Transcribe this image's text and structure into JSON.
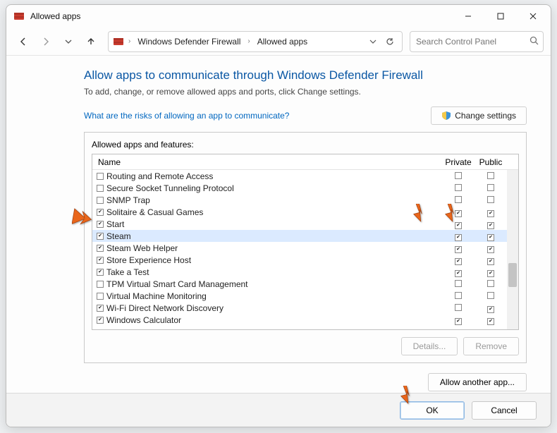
{
  "window": {
    "title": "Allowed apps"
  },
  "nav": {
    "breadcrumb": {
      "seg1": "Windows Defender Firewall",
      "seg2": "Allowed apps"
    },
    "search_placeholder": "Search Control Panel"
  },
  "page": {
    "heading": "Allow apps to communicate through Windows Defender Firewall",
    "sub": "To add, change, or remove allowed apps and ports, click Change settings.",
    "risk_link": "What are the risks of allowing an app to communicate?",
    "change_settings": "Change settings"
  },
  "list": {
    "label": "Allowed apps and features:",
    "col_name": "Name",
    "col_private": "Private",
    "col_public": "Public",
    "rows": [
      {
        "enabled": false,
        "name": "Routing and Remote Access",
        "private": false,
        "public": false
      },
      {
        "enabled": false,
        "name": "Secure Socket Tunneling Protocol",
        "private": false,
        "public": false
      },
      {
        "enabled": false,
        "name": "SNMP Trap",
        "private": false,
        "public": false
      },
      {
        "enabled": true,
        "name": "Solitaire & Casual Games",
        "private": true,
        "public": true
      },
      {
        "enabled": true,
        "name": "Start",
        "private": true,
        "public": true
      },
      {
        "enabled": true,
        "name": "Steam",
        "private": true,
        "public": true,
        "selected": true
      },
      {
        "enabled": true,
        "name": "Steam Web Helper",
        "private": true,
        "public": true
      },
      {
        "enabled": true,
        "name": "Store Experience Host",
        "private": true,
        "public": true
      },
      {
        "enabled": true,
        "name": "Take a Test",
        "private": true,
        "public": true
      },
      {
        "enabled": false,
        "name": "TPM Virtual Smart Card Management",
        "private": false,
        "public": false
      },
      {
        "enabled": false,
        "name": "Virtual Machine Monitoring",
        "private": false,
        "public": false
      },
      {
        "enabled": true,
        "name": "Wi-Fi Direct Network Discovery",
        "private": false,
        "public": true
      },
      {
        "enabled": true,
        "name": "Windows Calculator",
        "private": true,
        "public": true
      }
    ],
    "details": "Details...",
    "remove": "Remove",
    "allow_another": "Allow another app..."
  },
  "footer": {
    "ok": "OK",
    "cancel": "Cancel"
  }
}
